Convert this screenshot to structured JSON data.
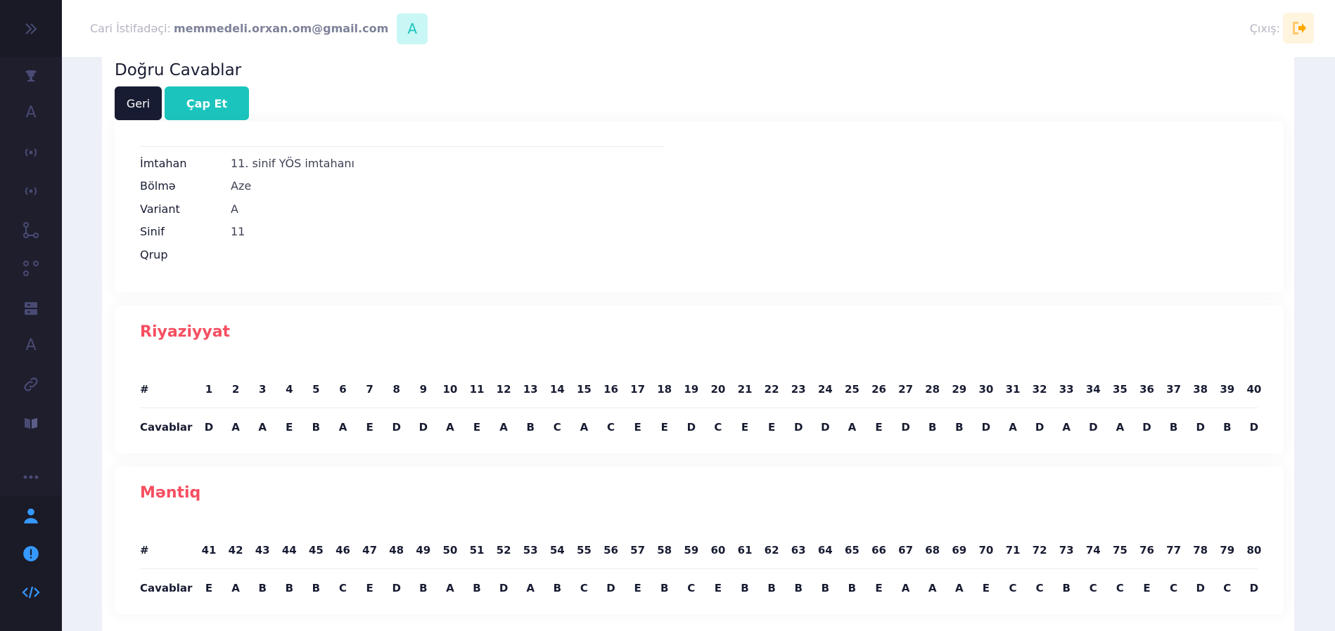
{
  "header": {
    "user_label": "Cari İstifadəçi:",
    "user_email": "memmedeli.orxan.om@gmail.com",
    "avatar_letter": "A",
    "logout_label": "Çıxış:"
  },
  "sidebar": {
    "icons": [
      "chevrons-right-icon",
      "trophy-icon",
      "letter-a-icon",
      "broadcast-icon",
      "broadcast-icon",
      "nodes-icon",
      "dots-grid-icon",
      "server-icon",
      "letter-a-icon",
      "link-icon",
      "book-icon",
      "more-dots-icon",
      "user-icon",
      "alert-icon",
      "code-icon"
    ]
  },
  "page": {
    "title": "Doğru Cavablar",
    "back_label": "Geri",
    "print_label": "Çap Et"
  },
  "info": [
    {
      "label": "İmtahan",
      "value": "11. sinif YÖS imtahanı"
    },
    {
      "label": "Bölmə",
      "value": "Aze"
    },
    {
      "label": "Variant",
      "value": "A"
    },
    {
      "label": "Sinif",
      "value": "11"
    },
    {
      "label": "Qrup",
      "value": ""
    }
  ],
  "sections": [
    {
      "title": "Riyaziyyat",
      "hash_label": "#",
      "answers_label": "Cavablar",
      "numbers": [
        "1",
        "2",
        "3",
        "4",
        "5",
        "6",
        "7",
        "8",
        "9",
        "10",
        "11",
        "12",
        "13",
        "14",
        "15",
        "16",
        "17",
        "18",
        "19",
        "20",
        "21",
        "22",
        "23",
        "24",
        "25",
        "26",
        "27",
        "28",
        "29",
        "30",
        "31",
        "32",
        "33",
        "34",
        "35",
        "36",
        "37",
        "38",
        "39",
        "40"
      ],
      "answers": [
        "D",
        "A",
        "A",
        "E",
        "B",
        "A",
        "E",
        "D",
        "D",
        "A",
        "E",
        "A",
        "B",
        "C",
        "A",
        "C",
        "E",
        "E",
        "D",
        "C",
        "E",
        "E",
        "D",
        "D",
        "A",
        "E",
        "D",
        "B",
        "B",
        "D",
        "A",
        "D",
        "A",
        "D",
        "A",
        "D",
        "B",
        "D",
        "B",
        "D"
      ]
    },
    {
      "title": "Məntiq",
      "hash_label": "#",
      "answers_label": "Cavablar",
      "numbers": [
        "41",
        "42",
        "43",
        "44",
        "45",
        "46",
        "47",
        "48",
        "49",
        "50",
        "51",
        "52",
        "53",
        "54",
        "55",
        "56",
        "57",
        "58",
        "59",
        "60",
        "61",
        "62",
        "63",
        "64",
        "65",
        "66",
        "67",
        "68",
        "69",
        "70",
        "71",
        "72",
        "73",
        "74",
        "75",
        "76",
        "77",
        "78",
        "79",
        "80"
      ],
      "answers": [
        "E",
        "A",
        "B",
        "B",
        "B",
        "C",
        "E",
        "D",
        "B",
        "A",
        "B",
        "D",
        "A",
        "B",
        "C",
        "D",
        "E",
        "B",
        "C",
        "E",
        "B",
        "B",
        "B",
        "B",
        "B",
        "E",
        "A",
        "A",
        "A",
        "E",
        "C",
        "C",
        "B",
        "C",
        "C",
        "E",
        "C",
        "D",
        "C",
        "D"
      ]
    }
  ]
}
